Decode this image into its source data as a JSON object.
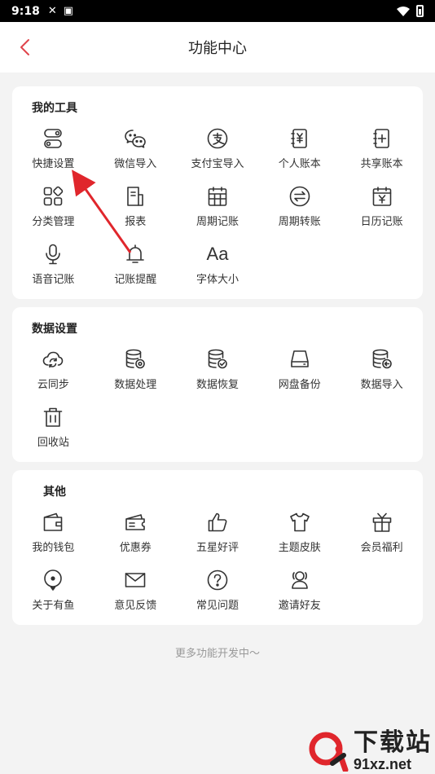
{
  "status_bar": {
    "time": "9:18"
  },
  "header": {
    "title": "功能中心"
  },
  "sections": [
    {
      "title": "我的工具",
      "items": [
        {
          "label": "快捷设置",
          "icon": "toggle-switch-icon"
        },
        {
          "label": "微信导入",
          "icon": "wechat-icon"
        },
        {
          "label": "支付宝导入",
          "icon": "alipay-icon"
        },
        {
          "label": "个人账本",
          "icon": "personal-ledger-icon"
        },
        {
          "label": "共享账本",
          "icon": "shared-ledger-icon"
        },
        {
          "label": "分类管理",
          "icon": "category-grid-icon"
        },
        {
          "label": "报表",
          "icon": "report-icon"
        },
        {
          "label": "周期记账",
          "icon": "calendar-grid-icon"
        },
        {
          "label": "周期转账",
          "icon": "transfer-icon"
        },
        {
          "label": "日历记账",
          "icon": "calendar-yen-icon"
        },
        {
          "label": "语音记账",
          "icon": "microphone-icon"
        },
        {
          "label": "记账提醒",
          "icon": "bell-icon"
        },
        {
          "label": "字体大小",
          "icon": "font-size-icon",
          "glyph": "Aa"
        }
      ]
    },
    {
      "title": "数据设置",
      "items": [
        {
          "label": "云同步",
          "icon": "cloud-sync-icon"
        },
        {
          "label": "数据处理",
          "icon": "database-gear-icon"
        },
        {
          "label": "数据恢复",
          "icon": "database-check-icon"
        },
        {
          "label": "网盘备份",
          "icon": "drive-icon"
        },
        {
          "label": "数据导入",
          "icon": "database-import-icon"
        },
        {
          "label": "回收站",
          "icon": "trash-icon"
        }
      ]
    },
    {
      "title": "其他",
      "items": [
        {
          "label": "我的钱包",
          "icon": "wallet-icon"
        },
        {
          "label": "优惠券",
          "icon": "coupon-icon"
        },
        {
          "label": "五星好评",
          "icon": "thumbs-up-icon"
        },
        {
          "label": "主题皮肤",
          "icon": "tshirt-icon"
        },
        {
          "label": "会员福利",
          "icon": "gift-icon"
        },
        {
          "label": "关于有鱼",
          "icon": "location-pin-icon"
        },
        {
          "label": "意见反馈",
          "icon": "mail-icon"
        },
        {
          "label": "常见问题",
          "icon": "question-icon"
        },
        {
          "label": "邀请好友",
          "icon": "invite-friends-icon"
        }
      ]
    }
  ],
  "footer": {
    "text": "更多功能开发中～"
  },
  "watermark": {
    "title": "下载站",
    "url": "91xz.net"
  },
  "colors": {
    "accent": "#e0444c",
    "annotation_arrow": "#e0262c"
  }
}
